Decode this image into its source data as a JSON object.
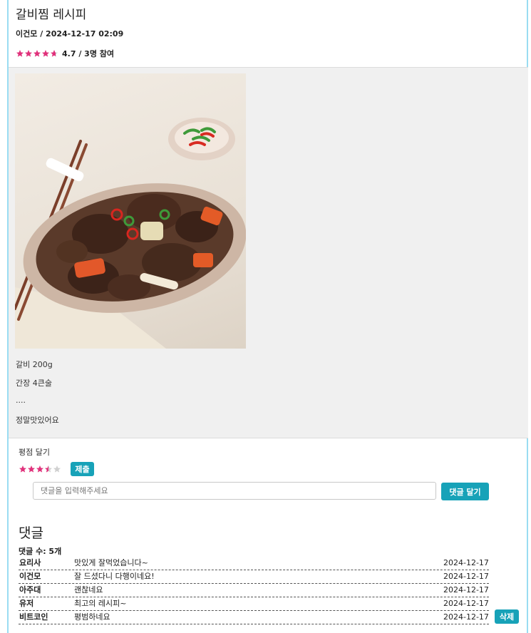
{
  "post": {
    "title": "갈비찜 레시피",
    "author_date": "이건모 / 2024-12-17 02:09",
    "rating_text": "4.7 / 3명 참여",
    "rating_value": 4.7,
    "star_color": "#e0317b"
  },
  "content": {
    "image_alt": "갈비찜 사진",
    "lines": [
      "갈비 200g",
      "간장 4큰술",
      "....",
      "정말맛있어요"
    ]
  },
  "rate": {
    "label": "평점 달기",
    "selected_value": 3.5,
    "submit_label": "제출"
  },
  "comment_form": {
    "placeholder": "댓글을 입력해주세요",
    "submit_label": "댓글 달기"
  },
  "comments": {
    "title": "댓글",
    "count_label": "댓글 수: 5개",
    "items": [
      {
        "author": "요리사",
        "text": "맛있게 잘먹었습니다~",
        "date": "2024-12-17"
      },
      {
        "author": "이건모",
        "text": "잘 드셨다니 다행이네요!",
        "date": "2024-12-17"
      },
      {
        "author": "아주대",
        "text": "괜찮네요",
        "date": "2024-12-17"
      },
      {
        "author": "유저",
        "text": "최고의 레시피~",
        "date": "2024-12-17"
      },
      {
        "author": "비트코인",
        "text": "평범하네요",
        "date": "2024-12-17"
      }
    ],
    "delete_label": "삭제"
  },
  "colors": {
    "accent": "#17a2b8",
    "frame_border": "#9adcf2",
    "content_bg": "#f0f0f0"
  }
}
